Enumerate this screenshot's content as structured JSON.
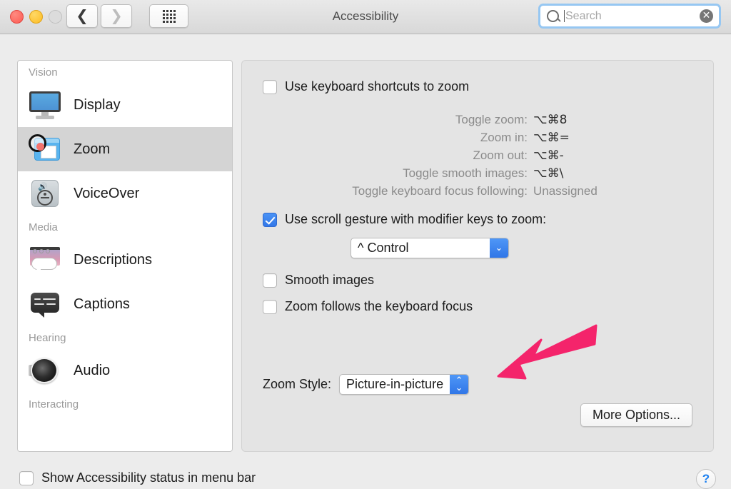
{
  "window": {
    "title": "Accessibility",
    "traffic_lights": [
      "close",
      "minimize",
      "zoom"
    ],
    "back_icon": "chevron-left-icon",
    "forward_icon": "chevron-right-icon",
    "grid_icon": "show-all-grid-icon"
  },
  "search": {
    "placeholder": "Search",
    "value": "",
    "icon": "search-icon",
    "clear_icon": "clear-circle-icon",
    "clear_glyph": "✕",
    "focus_ring_color": "#96c7f2"
  },
  "sidebar": {
    "groups": [
      {
        "label": "Vision",
        "items": [
          {
            "label": "Display",
            "icon": "display-monitor-icon",
            "selected": false
          },
          {
            "label": "Zoom",
            "icon": "zoom-magnifier-icon",
            "selected": true
          },
          {
            "label": "VoiceOver",
            "icon": "voiceover-icon",
            "selected": false
          }
        ]
      },
      {
        "label": "Media",
        "items": [
          {
            "label": "Descriptions",
            "icon": "descriptions-icon",
            "selected": false
          },
          {
            "label": "Captions",
            "icon": "captions-icon",
            "selected": false
          }
        ]
      },
      {
        "label": "Hearing",
        "items": [
          {
            "label": "Audio",
            "icon": "audio-speaker-icon",
            "selected": false
          }
        ]
      },
      {
        "label": "Interacting",
        "items": []
      }
    ]
  },
  "main": {
    "keyboard_shortcuts_checkbox": {
      "label": "Use keyboard shortcuts to zoom",
      "checked": false
    },
    "shortcuts": [
      {
        "name": "Toggle zoom:",
        "value": "⌥⌘8"
      },
      {
        "name": "Zoom in:",
        "value": "⌥⌘="
      },
      {
        "name": "Zoom out:",
        "value": "⌥⌘-"
      },
      {
        "name": "Toggle smooth images:",
        "value": "⌥⌘\\"
      },
      {
        "name": "Toggle keyboard focus following:",
        "value": "Unassigned"
      }
    ],
    "scroll_gesture_checkbox": {
      "label": "Use scroll gesture with modifier keys to zoom:",
      "checked": true
    },
    "modifier_popup": {
      "value": "^ Control",
      "chevron_glyph": "⌄",
      "accent_color": "#3076e7"
    },
    "smooth_images_checkbox": {
      "label": "Smooth images",
      "checked": false
    },
    "keyboard_focus_checkbox": {
      "label": "Zoom follows the keyboard focus",
      "checked": false
    },
    "zoom_style": {
      "label": "Zoom Style:",
      "value": "Picture-in-picture",
      "up_glyph": "⌃",
      "down_glyph": "⌄"
    },
    "more_options_button": "More Options..."
  },
  "annotation": {
    "arrow_color": "#F4246B",
    "points_at": "zoom-style-popup"
  },
  "footer": {
    "status_checkbox": {
      "label": "Show Accessibility status in menu bar",
      "checked": false
    },
    "help_button": "?"
  }
}
